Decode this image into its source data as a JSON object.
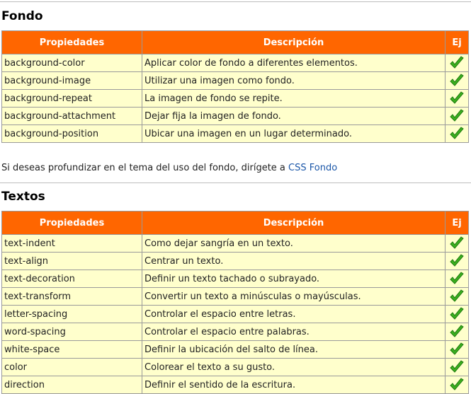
{
  "fondo": {
    "title": "Fondo",
    "headers": {
      "prop": "Propiedades",
      "desc": "Descripción",
      "ej": "Ej"
    },
    "rows": [
      {
        "prop": "background-color",
        "desc": "Aplicar color de fondo a diferentes elementos."
      },
      {
        "prop": "background-image",
        "desc": "Utilizar una imagen como fondo."
      },
      {
        "prop": "background-repeat",
        "desc": "La imagen de fondo se repite."
      },
      {
        "prop": "background-attachment",
        "desc": "Dejar fija la imagen de fondo."
      },
      {
        "prop": "background-position",
        "desc": "Ubicar una imagen en un lugar determinado."
      }
    ]
  },
  "note": {
    "text": "Si deseas profundizar en el tema del uso del fondo, dirígete a ",
    "link": "CSS Fondo"
  },
  "textos": {
    "title": "Textos",
    "headers": {
      "prop": "Propiedades",
      "desc": "Descripción",
      "ej": "Ej"
    },
    "rows": [
      {
        "prop": "text-indent",
        "desc": "Como dejar sangría en un texto."
      },
      {
        "prop": "text-align",
        "desc": "Centrar un texto."
      },
      {
        "prop": "text-decoration",
        "desc": "Definir un texto tachado o subrayado."
      },
      {
        "prop": "text-transform",
        "desc": "Convertir un texto a minúsculas o mayúsculas."
      },
      {
        "prop": "letter-spacing",
        "desc": "Controlar el espacio entre letras."
      },
      {
        "prop": "word-spacing",
        "desc": "Controlar el espacio entre palabras."
      },
      {
        "prop": "white-space",
        "desc": "Definir la ubicación del salto de línea."
      },
      {
        "prop": "color",
        "desc": "Colorear el texto a su gusto."
      },
      {
        "prop": "direction",
        "desc": "Definir el sentido de la escritura."
      }
    ]
  },
  "colors": {
    "header_bg": "#ff6600",
    "row_bg": "#ffffcc",
    "link": "#1a56a8",
    "check": "#3cb01f"
  },
  "icons": {
    "example": "green-checkmark-icon"
  }
}
